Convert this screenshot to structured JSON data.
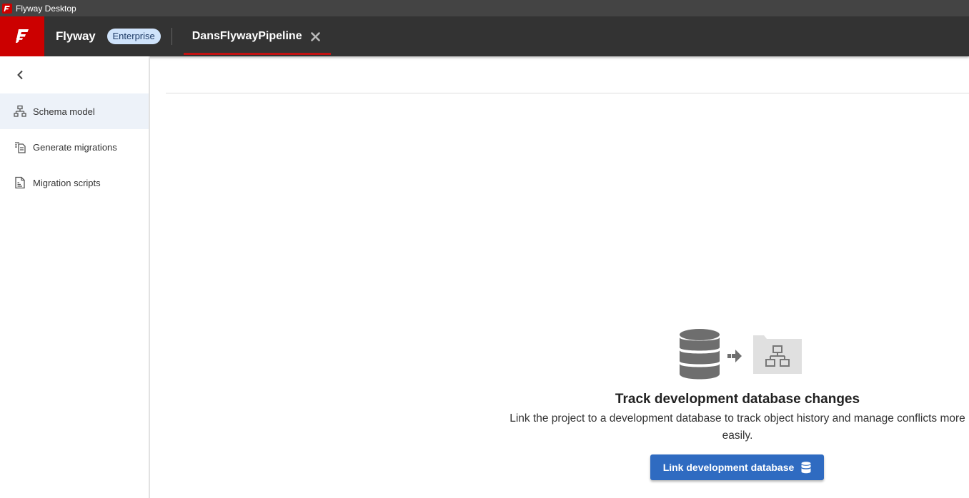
{
  "window": {
    "title": "Flyway Desktop"
  },
  "header": {
    "brand": "Flyway",
    "edition_badge": "Enterprise",
    "project_tab": "DansFlywayPipeline",
    "accent_color": "#cc0000"
  },
  "sidebar": {
    "items": [
      {
        "label": "Schema model",
        "icon": "schema-model-icon",
        "active": true
      },
      {
        "label": "Generate migrations",
        "icon": "generate-migrations-icon",
        "active": false
      },
      {
        "label": "Migration scripts",
        "icon": "migration-scripts-icon",
        "active": false
      }
    ]
  },
  "empty_state": {
    "title": "Track development database changes",
    "description": "Link the project to a development database to track object history and manage conflicts more easily.",
    "button_label": "Link development database",
    "button_color": "#2f6bc1"
  }
}
